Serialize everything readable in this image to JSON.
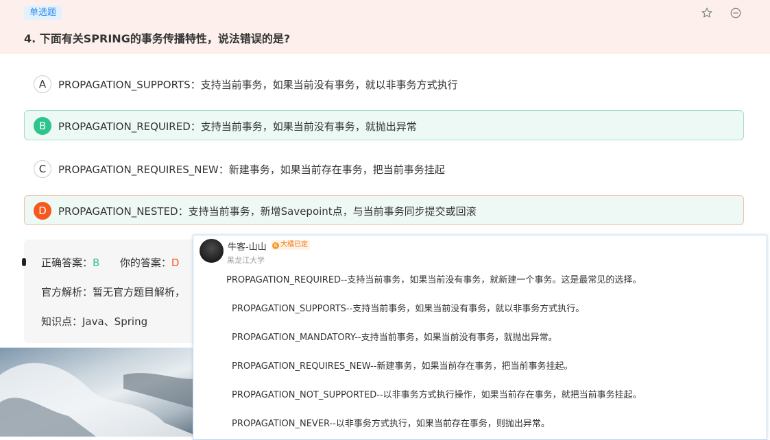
{
  "question": {
    "type_tag": "单选题",
    "title": "4. 下面有关SPRING的事务传播特性，说法错误的是?",
    "star_icon": "star-outline-icon",
    "collapse_icon": "minus-circle-icon"
  },
  "options": [
    {
      "letter": "A",
      "text": "PROPAGATION_SUPPORTS：支持当前事务，如果当前没有事务，就以非事务方式执行",
      "state": "normal"
    },
    {
      "letter": "B",
      "text": "PROPAGATION_REQUIRED：支持当前事务，如果当前没有事务，就抛出异常",
      "state": "correct"
    },
    {
      "letter": "C",
      "text": "PROPAGATION_REQUIRES_NEW：新建事务，如果当前存在事务，把当前事务挂起",
      "state": "normal"
    },
    {
      "letter": "D",
      "text": "PROPAGATION_NESTED：支持当前事务，新增Savepoint点，与当前事务同步提交或回滚",
      "state": "wrong"
    }
  ],
  "answer": {
    "correct_label": "正确答案：",
    "correct_value": "B",
    "yours_label": "你的答案：",
    "yours_value": "D",
    "analysis": "官方解析：暂无官方题目解析，",
    "knowledge": "知识点：Java、Spring"
  },
  "popup": {
    "user_name": "牛客-山山",
    "badge_text": "大橘已定",
    "badge_level": "6",
    "school": "黑龙江大学",
    "lines": [
      "PROPAGATION_REQUIRED--支持当前事务，如果当前没有事务，就新建一个事务。这是最常见的选择。",
      "PROPAGATION_SUPPORTS--支持当前事务，如果当前没有事务，就以非事务方式执行。",
      "PROPAGATION_MANDATORY--支持当前事务，如果当前没有事务，就抛出异常。",
      "PROPAGATION_REQUIRES_NEW--新建事务，如果当前存在事务，把当前事务挂起。",
      "PROPAGATION_NOT_SUPPORTED--以非事务方式执行操作，如果当前存在事务，就把当前事务挂起。",
      "PROPAGATION_NEVER--以非事务方式执行，如果当前存在事务，则抛出异常。"
    ]
  },
  "colors": {
    "correct": "#2ec48d",
    "wrong": "#f5591e",
    "header_bg": "#fdf0ec",
    "tag": "#2e8ae6"
  }
}
